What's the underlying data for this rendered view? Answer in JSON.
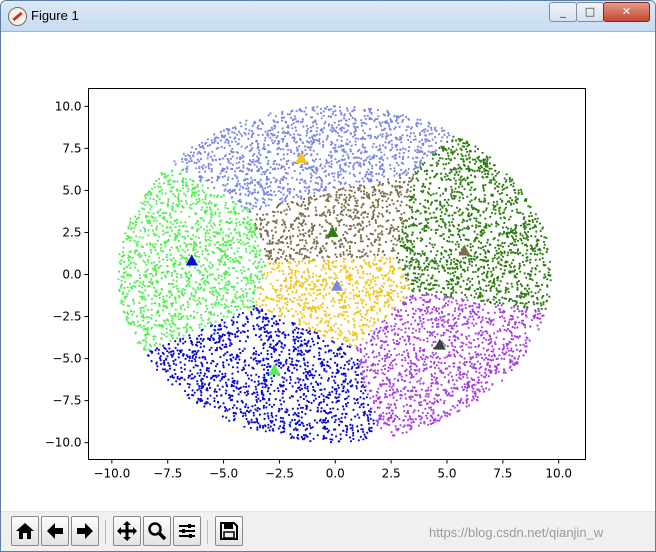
{
  "window": {
    "title": "Figure 1",
    "minimize_label": "_",
    "maximize_label": "□",
    "close_label": "✕"
  },
  "toolbar": {
    "buttons": [
      {
        "name": "home-icon",
        "label": "Home"
      },
      {
        "name": "back-icon",
        "label": "Back"
      },
      {
        "name": "forward-icon",
        "label": "Forward"
      },
      {
        "name": "pan-icon",
        "label": "Pan"
      },
      {
        "name": "zoom-icon",
        "label": "Zoom"
      },
      {
        "name": "configure-subplots-icon",
        "label": "Configure subplots"
      },
      {
        "name": "save-icon",
        "label": "Save"
      }
    ]
  },
  "watermark": "https://blog.csdn.net/qianjin_w",
  "chart_data": {
    "type": "scatter",
    "title": "",
    "xlabel": "",
    "ylabel": "",
    "xlim": [
      -11,
      11.2
    ],
    "ylim": [
      -11,
      11
    ],
    "xticks": [
      -10.0,
      -7.5,
      -5.0,
      -2.5,
      0.0,
      2.5,
      5.0,
      7.5,
      10.0
    ],
    "yticks": [
      -10.0,
      -7.5,
      -5.0,
      -2.5,
      0.0,
      2.5,
      5.0,
      7.5,
      10.0
    ],
    "xtick_labels": [
      "−10.0",
      "−7.5",
      "−5.0",
      "−2.5",
      "0.0",
      "2.5",
      "5.0",
      "7.5",
      "10.0"
    ],
    "ytick_labels": [
      "−10.0",
      "−7.5",
      "−5.0",
      "−2.5",
      "0.0",
      "2.5",
      "5.0",
      "7.5",
      "10.0"
    ],
    "grid": false,
    "point_region": {
      "shape": "ellipse",
      "x_range": [
        -9.7,
        9.7
      ],
      "y_range": [
        -10.0,
        10.0
      ]
    },
    "clusters": [
      {
        "color": "#7b87e0",
        "centroid": [
          -1.5,
          6.9
        ],
        "marker_color": "#f0c520"
      },
      {
        "color": "#2e7d12",
        "centroid": [
          5.8,
          1.4
        ],
        "marker_color": "#7a6e4c"
      },
      {
        "color": "#7a6e4c",
        "centroid": [
          -0.1,
          2.5
        ],
        "marker_color": "#2e7d12"
      },
      {
        "color": "#55ef55",
        "centroid": [
          -6.4,
          0.8
        ],
        "marker_color": "#0a0ad0"
      },
      {
        "color": "#f0c520",
        "centroid": [
          0.1,
          -0.7
        ],
        "marker_color": "#7b87e0"
      },
      {
        "color": "#0a0ad0",
        "centroid": [
          -2.7,
          -5.7
        ],
        "marker_color": "#55ef55"
      },
      {
        "color": "#a640e0",
        "centroid": [
          4.7,
          -4.2
        ],
        "marker_color": "#2f4a2f"
      }
    ]
  }
}
